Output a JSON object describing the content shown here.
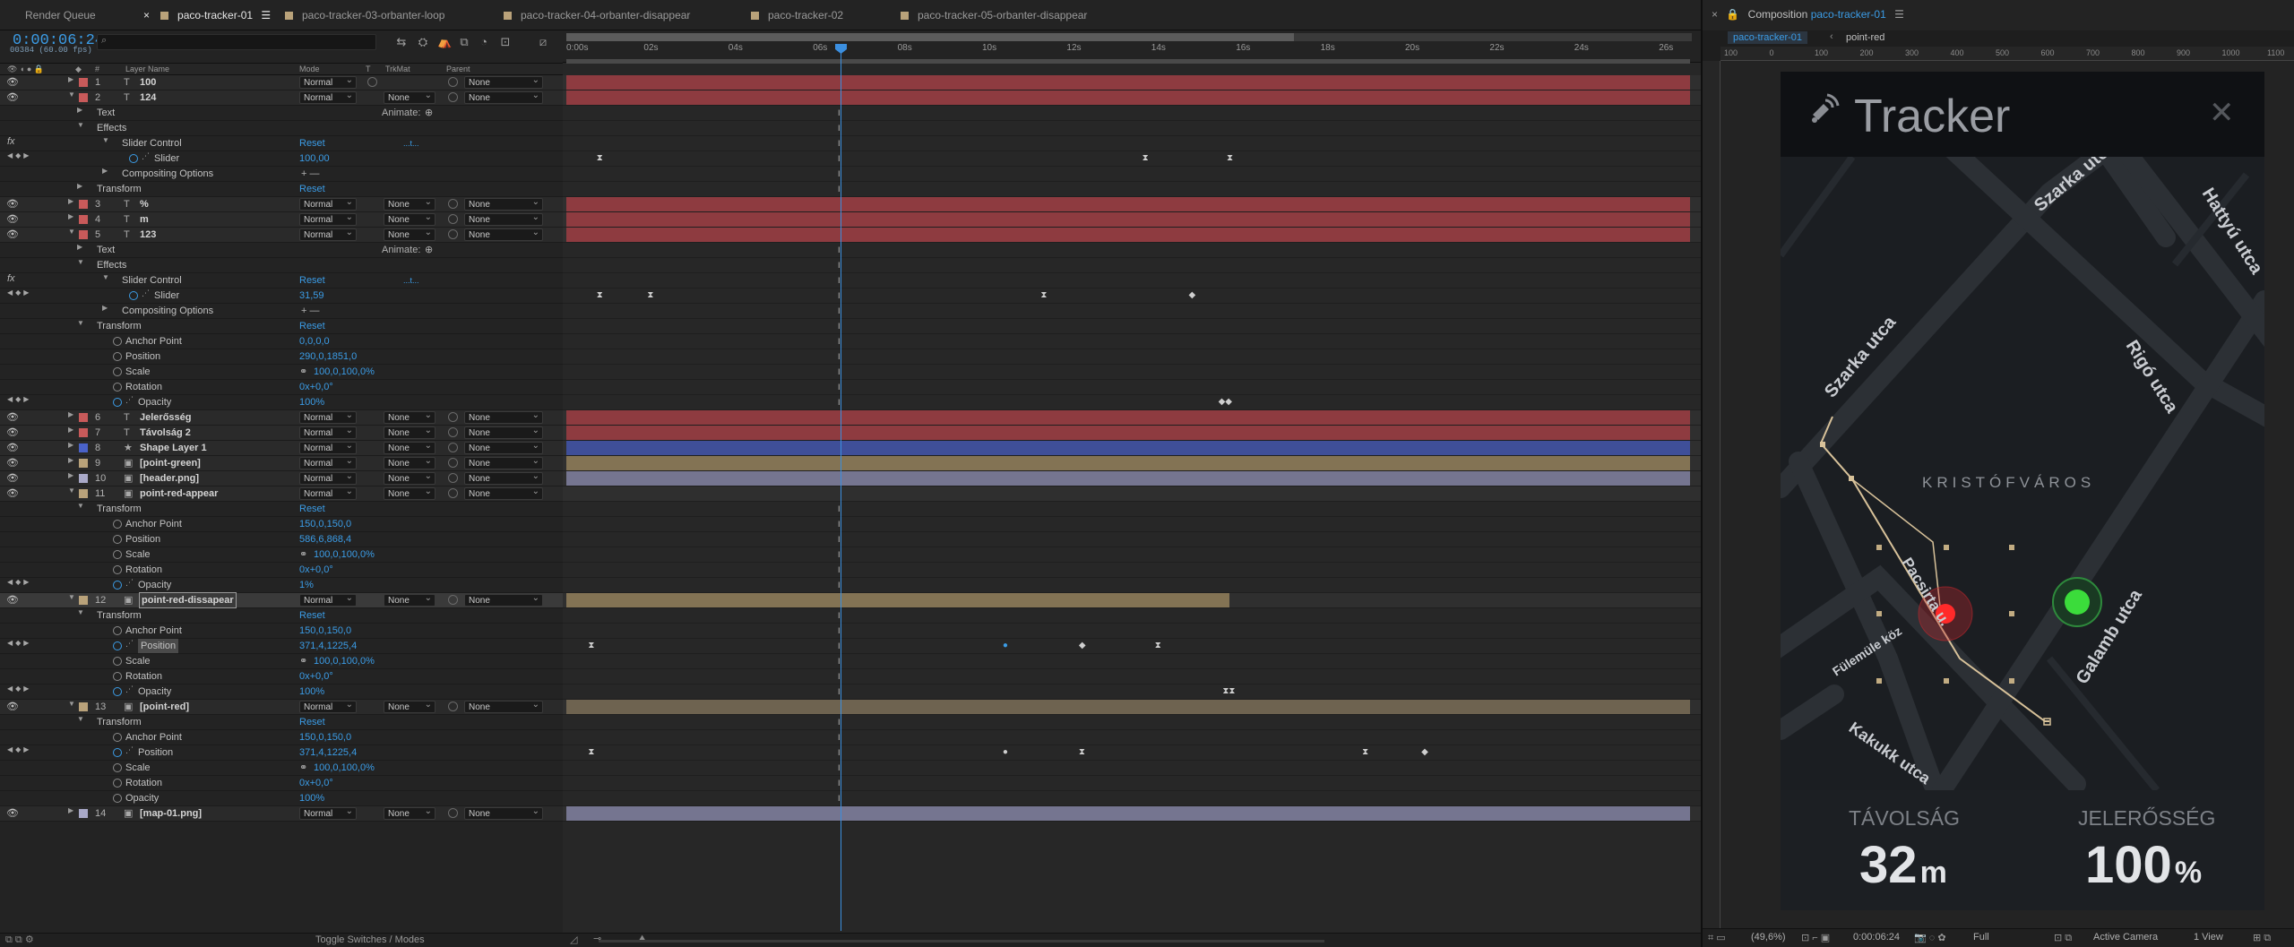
{
  "tabs": [
    {
      "label": "Render Queue",
      "swatch": null,
      "active": false
    },
    {
      "label": "paco-tracker-01",
      "swatch": "#b9a27a",
      "active": true
    },
    {
      "label": "paco-tracker-03-orbanter-loop",
      "swatch": "#b9a27a",
      "active": false
    },
    {
      "label": "paco-tracker-04-orbanter-disappear",
      "swatch": "#b9a27a",
      "active": false
    },
    {
      "label": "paco-tracker-02",
      "swatch": "#b9a27a",
      "active": false
    },
    {
      "label": "paco-tracker-05-orbanter-disappear",
      "swatch": "#b9a27a",
      "active": false
    }
  ],
  "timeline": {
    "timecode": "0:00:06:24",
    "frames": "00384 (60.00 fps)",
    "columns": {
      "num": "#",
      "layer_name": "Layer Name",
      "mode": "Mode",
      "t": "T",
      "trkmat": "TrkMat",
      "parent": "Parent"
    },
    "ruler_ticks": [
      "0:00s",
      "02s",
      "04s",
      "06s",
      "08s",
      "10s",
      "12s",
      "14s",
      "16s",
      "18s",
      "20s",
      "22s",
      "24s",
      "26s"
    ],
    "toggle_label": "Toggle Switches / Modes"
  },
  "rows": [
    {
      "kind": "layer",
      "num": "1",
      "name": "100",
      "type": "T",
      "color": "#c85a5a",
      "mode": "Normal",
      "trkmat": "",
      "parent": "None",
      "bar": "#8e3b40"
    },
    {
      "kind": "layer",
      "num": "2",
      "name": "124",
      "type": "T",
      "color": "#c85a5a",
      "mode": "Normal",
      "trkmat": "None",
      "parent": "None",
      "bar": "#8e3b40",
      "open": true
    },
    {
      "kind": "group",
      "level": 1,
      "name": "Text",
      "extra": "Animate:"
    },
    {
      "kind": "group",
      "level": 1,
      "name": "Effects",
      "open": true
    },
    {
      "kind": "group",
      "level": 2,
      "name": "Slider Control",
      "reset": "Reset",
      "extra2": "...t...",
      "fx": true,
      "open": true
    },
    {
      "kind": "prop",
      "level": 3,
      "name": "Slider",
      "value": "100,00",
      "kfnav": true,
      "graph": true
    },
    {
      "kind": "group",
      "level": 2,
      "name": "Compositing Options",
      "extra": "+ —"
    },
    {
      "kind": "group",
      "level": 1,
      "name": "Transform",
      "reset": "Reset"
    },
    {
      "kind": "layer",
      "num": "3",
      "name": "%",
      "type": "T",
      "color": "#c85a5a",
      "mode": "Normal",
      "trkmat": "None",
      "parent": "None",
      "bar": "#8e3b40"
    },
    {
      "kind": "layer",
      "num": "4",
      "name": "m",
      "type": "T",
      "color": "#c85a5a",
      "mode": "Normal",
      "trkmat": "None",
      "parent": "None",
      "bar": "#8e3b40"
    },
    {
      "kind": "layer",
      "num": "5",
      "name": "123",
      "type": "T",
      "color": "#c85a5a",
      "mode": "Normal",
      "trkmat": "None",
      "parent": "None",
      "bar": "#8e3b40",
      "open": true
    },
    {
      "kind": "group",
      "level": 1,
      "name": "Text",
      "extra": "Animate:"
    },
    {
      "kind": "group",
      "level": 1,
      "name": "Effects",
      "open": true
    },
    {
      "kind": "group",
      "level": 2,
      "name": "Slider Control",
      "reset": "Reset",
      "extra2": "...t...",
      "fx": true,
      "open": true
    },
    {
      "kind": "prop",
      "level": 3,
      "name": "Slider",
      "value": "31,59",
      "kfnav": true,
      "graph": true
    },
    {
      "kind": "group",
      "level": 2,
      "name": "Compositing Options",
      "extra": "+ —"
    },
    {
      "kind": "group",
      "level": 1,
      "name": "Transform",
      "reset": "Reset",
      "open": true
    },
    {
      "kind": "prop",
      "level": 2,
      "name": "Anchor Point",
      "value": "0,0,0,0"
    },
    {
      "kind": "prop",
      "level": 2,
      "name": "Position",
      "value": "290,0,1851,0"
    },
    {
      "kind": "prop",
      "level": 2,
      "name": "Scale",
      "value": "100,0,100,0%",
      "link": true
    },
    {
      "kind": "prop",
      "level": 2,
      "name": "Rotation",
      "value": "0x+0,0°"
    },
    {
      "kind": "prop",
      "level": 2,
      "name": "Opacity",
      "value": "100%",
      "kfnav": true,
      "graph": true
    },
    {
      "kind": "layer",
      "num": "6",
      "name": "Jelerősség",
      "type": "T",
      "color": "#c85a5a",
      "mode": "Normal",
      "trkmat": "None",
      "parent": "None",
      "bar": "#8e3b40"
    },
    {
      "kind": "layer",
      "num": "7",
      "name": "Távolság 2",
      "type": "T",
      "color": "#c85a5a",
      "mode": "Normal",
      "trkmat": "None",
      "parent": "None",
      "bar": "#8e3b40"
    },
    {
      "kind": "layer",
      "num": "8",
      "name": "Shape Layer 1",
      "type": "★",
      "color": "#4a62c8",
      "mode": "Normal",
      "trkmat": "None",
      "parent": "None",
      "bar": "#3f4f99"
    },
    {
      "kind": "layer",
      "num": "9",
      "name": "[point-green]",
      "type": "▣",
      "color": "#b9a27a",
      "mode": "Normal",
      "trkmat": "None",
      "parent": "None",
      "bar": "#837354"
    },
    {
      "kind": "layer",
      "num": "10",
      "name": "[header.png]",
      "type": "▣",
      "color": "#a9a9c8",
      "mode": "Normal",
      "trkmat": "None",
      "parent": "None",
      "bar": "#757590"
    },
    {
      "kind": "layer",
      "num": "11",
      "name": "point-red-appear",
      "type": "▣",
      "color": "#b9a27a",
      "mode": "Normal",
      "trkmat": "None",
      "parent": "None",
      "bar": null,
      "open": true
    },
    {
      "kind": "group",
      "level": 1,
      "name": "Transform",
      "reset": "Reset",
      "open": true
    },
    {
      "kind": "prop",
      "level": 2,
      "name": "Anchor Point",
      "value": "150,0,150,0"
    },
    {
      "kind": "prop",
      "level": 2,
      "name": "Position",
      "value": "586,6,868,4"
    },
    {
      "kind": "prop",
      "level": 2,
      "name": "Scale",
      "value": "100,0,100,0%",
      "link": true
    },
    {
      "kind": "prop",
      "level": 2,
      "name": "Rotation",
      "value": "0x+0,0°"
    },
    {
      "kind": "prop",
      "level": 2,
      "name": "Opacity",
      "value": "1%",
      "kfnav": true,
      "graph": true
    },
    {
      "kind": "layer",
      "num": "12",
      "name": "point-red-dissapear",
      "type": "▣",
      "color": "#b9a27a",
      "mode": "Normal",
      "trkmat": "None",
      "parent": "None",
      "bar": "#837354",
      "selected": true,
      "open": true
    },
    {
      "kind": "group",
      "level": 1,
      "name": "Transform",
      "reset": "Reset",
      "open": true
    },
    {
      "kind": "prop",
      "level": 2,
      "name": "Anchor Point",
      "value": "150,0,150,0"
    },
    {
      "kind": "prop",
      "level": 2,
      "name": "Position",
      "value": "371,4,1225,4",
      "kfnav": true,
      "graph": true,
      "selected": true
    },
    {
      "kind": "prop",
      "level": 2,
      "name": "Scale",
      "value": "100,0,100,0%",
      "link": true
    },
    {
      "kind": "prop",
      "level": 2,
      "name": "Rotation",
      "value": "0x+0,0°"
    },
    {
      "kind": "prop",
      "level": 2,
      "name": "Opacity",
      "value": "100%",
      "kfnav": true,
      "graph": true
    },
    {
      "kind": "layer",
      "num": "13",
      "name": "[point-red]",
      "type": "▣",
      "color": "#b9a27a",
      "mode": "Normal",
      "trkmat": "None",
      "parent": "None",
      "bar": "#6e6350",
      "open": true
    },
    {
      "kind": "group",
      "level": 1,
      "name": "Transform",
      "reset": "Reset",
      "open": true
    },
    {
      "kind": "prop",
      "level": 2,
      "name": "Anchor Point",
      "value": "150,0,150,0"
    },
    {
      "kind": "prop",
      "level": 2,
      "name": "Position",
      "value": "371,4,1225,4",
      "kfnav": true,
      "graph": true
    },
    {
      "kind": "prop",
      "level": 2,
      "name": "Scale",
      "value": "100,0,100,0%",
      "link": true
    },
    {
      "kind": "prop",
      "level": 2,
      "name": "Rotation",
      "value": "0x+0,0°"
    },
    {
      "kind": "prop",
      "level": 2,
      "name": "Opacity",
      "value": "100%"
    },
    {
      "kind": "layer",
      "num": "14",
      "name": "[map-01.png]",
      "type": "▣",
      "color": "#a9a9c8",
      "mode": "Normal",
      "trkmat": "None",
      "parent": "None",
      "bar": "#757590"
    }
  ],
  "keyframes": {
    "5": [
      {
        "t": 0.8,
        "s": "⧗"
      },
      {
        "t": 13.7,
        "s": "⧗"
      },
      {
        "t": 15.7,
        "s": "⧗"
      }
    ],
    "14": [
      {
        "t": 0.8,
        "s": "⧗"
      },
      {
        "t": 2.0,
        "s": "⧗"
      },
      {
        "t": 11.3,
        "s": "⧗"
      },
      {
        "t": 14.8,
        "s": "◆"
      }
    ],
    "21": [
      {
        "t": 15.5,
        "s": "◆◆"
      }
    ],
    "32": [
      {
        "t": 15.7,
        "s": ""
      }
    ],
    "37": [
      {
        "t": 0.6,
        "s": "⧗"
      },
      {
        "t": 10.4,
        "s": "●",
        "blue": true
      },
      {
        "t": 12.2,
        "s": "◆"
      },
      {
        "t": 14.0,
        "s": "⧗"
      }
    ],
    "40": [
      {
        "t": 15.6,
        "s": "⧗⧗"
      }
    ],
    "44": [
      {
        "t": 0.6,
        "s": "⧗"
      },
      {
        "t": 10.4,
        "s": "●"
      },
      {
        "t": 12.2,
        "s": "⧗"
      },
      {
        "t": 18.9,
        "s": "⧗"
      },
      {
        "t": 20.3,
        "s": "◆"
      }
    ]
  },
  "composition": {
    "title_prefix": "Composition",
    "title_name": "paco-tracker-01",
    "sub_tab": "paco-tracker-01",
    "sub_crumb": "point-red",
    "ruler_labels": [
      "100",
      "0",
      "100",
      "200",
      "300",
      "400",
      "500",
      "600",
      "700",
      "800",
      "900",
      "1000",
      "1100"
    ],
    "app_title": "Tracker",
    "map_label": "KRISTÓFVÁROS",
    "streets": [
      "Szarka utca",
      "Szarka utca",
      "Hattyú utca",
      "Rigó utca",
      "Pacsirta u.",
      "Fülemüle köz",
      "Galamb utca",
      "Kakukk utca"
    ],
    "stat_left_label": "TÁVOLSÁG",
    "stat_left_value": "32",
    "stat_left_unit": "m",
    "stat_right_label": "JELERŐSSÉG",
    "stat_right_value": "100",
    "stat_right_unit": "%",
    "footer_zoom": "(49,6%)",
    "footer_time": "0:00:06:24",
    "footer_res": "Full",
    "footer_camera": "Active Camera",
    "footer_views": "1 View"
  }
}
